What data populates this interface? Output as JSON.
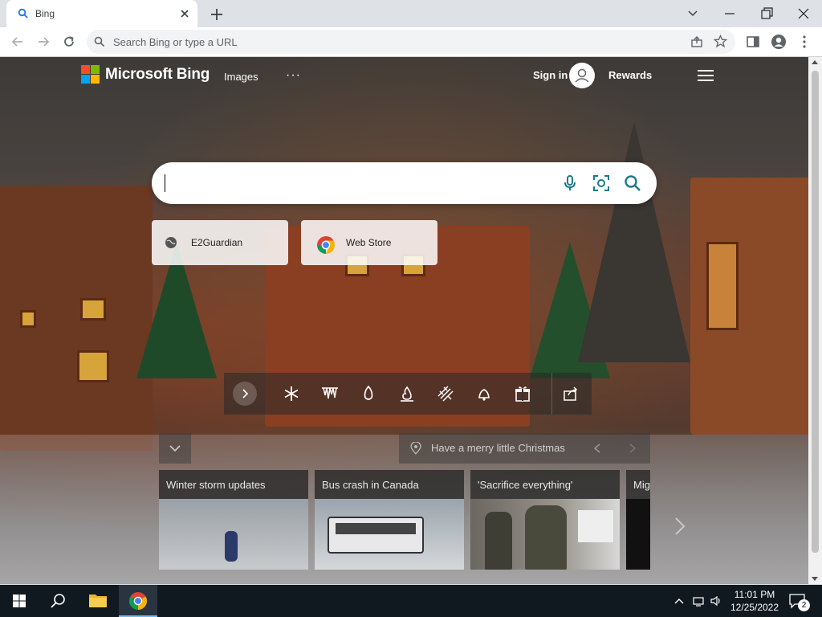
{
  "browser": {
    "tab": {
      "title": "Bing"
    },
    "omnibox": {
      "placeholder": "Search Bing or type a URL"
    }
  },
  "bing": {
    "brand": "Microsoft Bing",
    "nav": {
      "images": "Images",
      "more": "···"
    },
    "account": {
      "sign_in": "Sign in",
      "rewards": "Rewards"
    },
    "search": {
      "value": ""
    },
    "quick_links": [
      {
        "label": "E2Guardian",
        "icon": "globe-icon"
      },
      {
        "label": "Web Store",
        "icon": "chrome-icon"
      }
    ],
    "caption": "Have a merry little Christmas",
    "news": [
      {
        "title": "Winter storm updates"
      },
      {
        "title": "Bus crash in Canada"
      },
      {
        "title": "'Sacrifice everything'"
      },
      {
        "title": "Mig"
      }
    ]
  },
  "taskbar": {
    "time": "11:01 PM",
    "date": "12/25/2022",
    "notifications": "2"
  },
  "colors": {
    "accent": "#0078d4",
    "bing_teal": "#1a7a8c",
    "taskbar": "#101820"
  }
}
